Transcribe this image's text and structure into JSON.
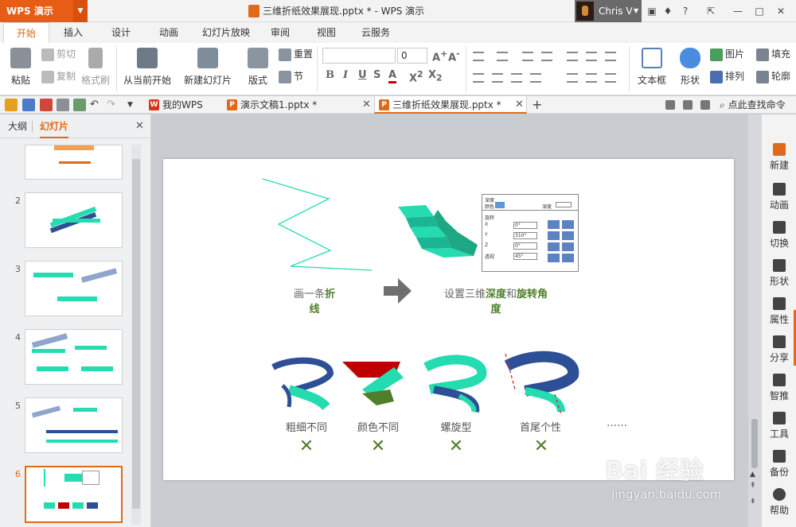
{
  "app": {
    "logo": "WPS 演示",
    "title": "三维折纸效果展现.pptx * - WPS 演示",
    "user": "Chris V"
  },
  "menu": [
    "开始",
    "插入",
    "设计",
    "动画",
    "幻灯片放映",
    "审阅",
    "视图",
    "云服务"
  ],
  "ribbon": {
    "paste": "粘贴",
    "cut": "剪切",
    "copy": "复制",
    "format_painter": "格式刷",
    "from_current": "从当前开始",
    "new_slide": "新建幻灯片",
    "layout": "版式",
    "reset": "重置",
    "section": "节",
    "font_size": "0",
    "textbox": "文本框",
    "shape": "形状",
    "picture": "图片",
    "arrange": "排列",
    "fill": "填充",
    "outline": "轮廓"
  },
  "quickbar": {
    "search": "点此查找命令"
  },
  "doc_tabs": [
    {
      "label": "我的WPS",
      "active": false
    },
    {
      "label": "演示文稿1.pptx *",
      "active": false
    },
    {
      "label": "三维折纸效果展现.pptx *",
      "active": true
    }
  ],
  "panel": {
    "outline_tab": "大纲",
    "slides_tab": "幻灯片",
    "thumb_numbers": [
      "2",
      "3",
      "4",
      "5",
      "6"
    ]
  },
  "slide": {
    "step1_a": "画一条",
    "step1_b": "折",
    "step1_c": "线",
    "step2_a": "设置三维",
    "step2_b": "深度",
    "step2_c": "和",
    "step2_d": "旋转角",
    "step2_e": "度",
    "dialog": {
      "top_left": "深度",
      "top_mid": "颜色",
      "top_right": "深度",
      "rotation": "旋转",
      "rows": [
        {
          "label": "X",
          "value": "0°"
        },
        {
          "label": "Y",
          "value": "310°"
        },
        {
          "label": "Z",
          "value": "0°"
        },
        {
          "label": "透视",
          "value": "45°"
        }
      ]
    },
    "labels": [
      "粗细不同",
      "颜色不同",
      "螺旋型",
      "首尾个性"
    ],
    "ellipsis": "……",
    "cross": "✕",
    "colors": {
      "teal": "#25dbb0",
      "blue": "#2d4f96",
      "red": "#c00000",
      "green": "#4f7f2a",
      "text": "#666666"
    }
  },
  "right_sidebar": [
    "新建",
    "动画",
    "切换",
    "形状",
    "属性",
    "分享",
    "智推",
    "工具",
    "备份",
    "帮助"
  ],
  "watermark": {
    "line1": "Bai 经验",
    "line2": "jingyan.baidu.com"
  }
}
